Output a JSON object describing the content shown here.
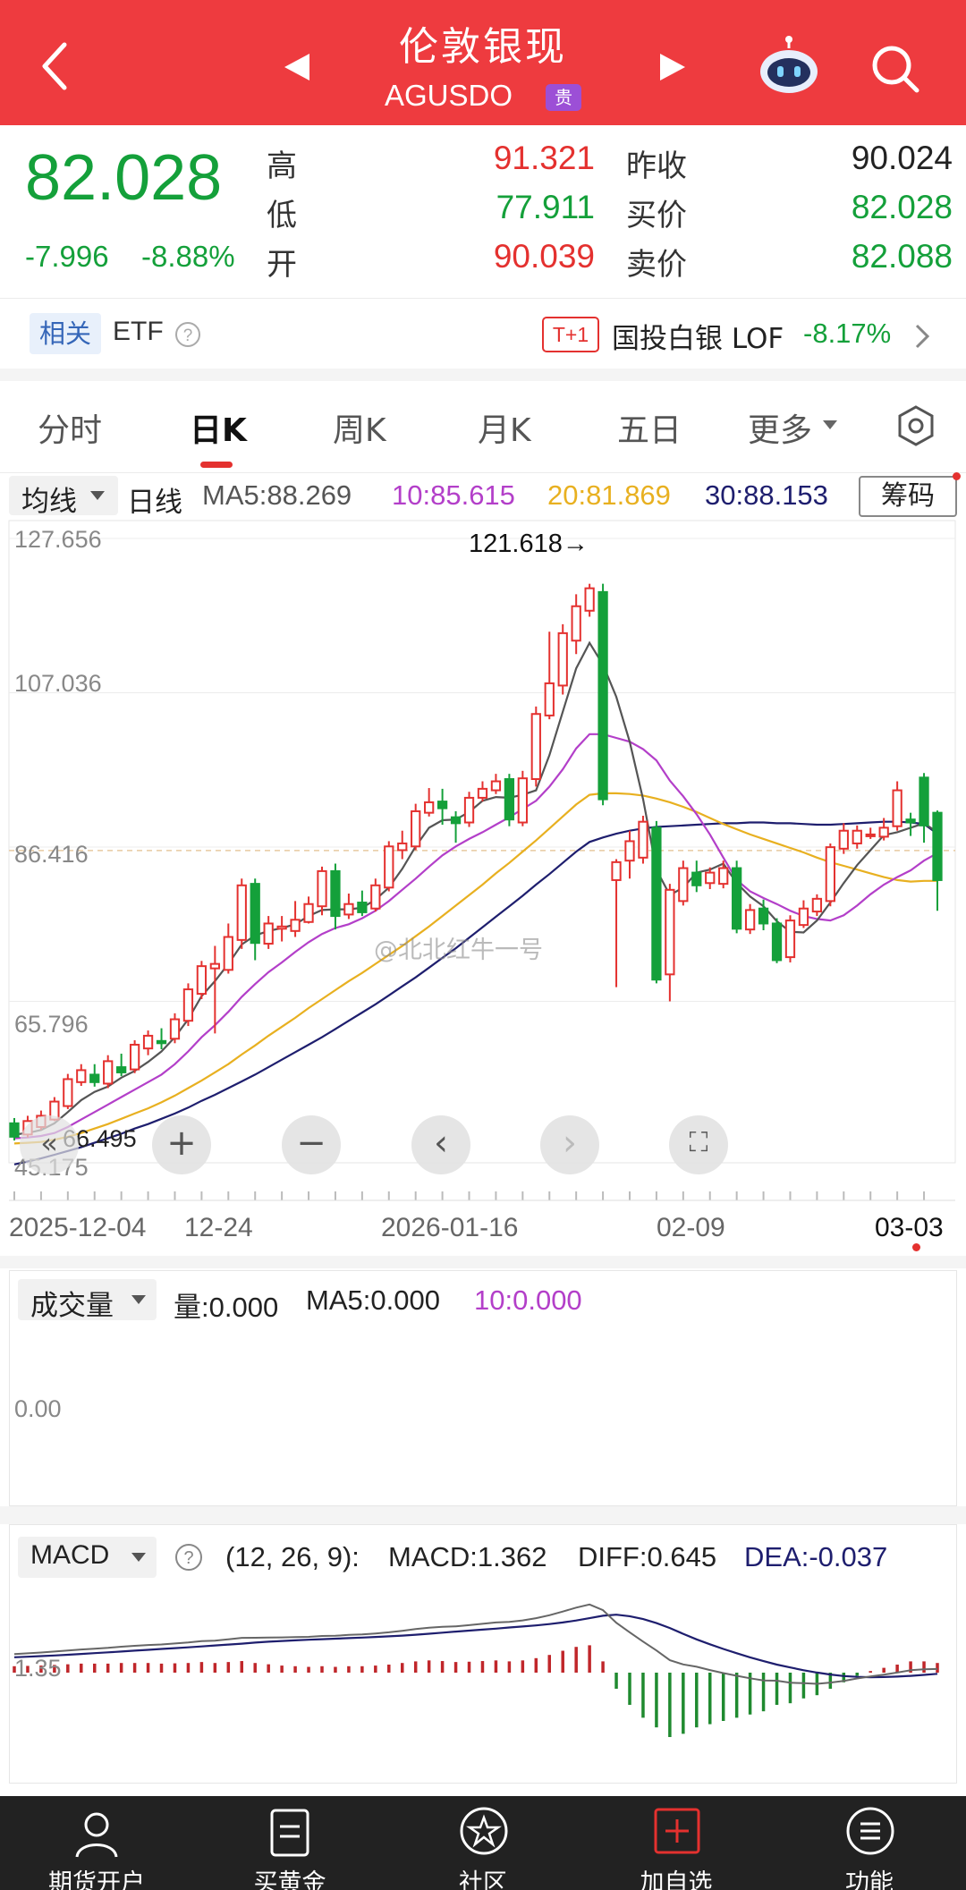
{
  "header": {
    "title": "伦敦银现",
    "code": "AGUSDO",
    "badge": "贵",
    "back_icon": "chevron-left-icon",
    "prev_icon": "triangle-left-icon",
    "next_icon": "triangle-right-icon",
    "robot_icon": "robot-icon",
    "search_icon": "search-icon"
  },
  "quote": {
    "price": "82.028",
    "change": "-7.996",
    "change_pct": "-8.88%",
    "high_label": "高",
    "high": "91.321",
    "low_label": "低",
    "low": "77.911",
    "open_label": "开",
    "open": "90.039",
    "prev_close_label": "昨收",
    "prev_close": "90.024",
    "bid_label": "买价",
    "bid": "82.028",
    "ask_label": "卖价",
    "ask": "82.088"
  },
  "related": {
    "tag": "相关",
    "etf": "ETF",
    "t1": "T+1",
    "fund": "国投白银 LOF",
    "fund_change": "-8.17%"
  },
  "tabs": [
    "分时",
    "日K",
    "周K",
    "月K",
    "五日",
    "更多"
  ],
  "active_tab": 1,
  "ma_bar": {
    "selector": "均线",
    "period": "日线",
    "ma5": "MA5:88.269",
    "ma10": "10:85.615",
    "ma20": "20:81.869",
    "ma30": "30:88.153",
    "chip_button": "筹码"
  },
  "price_axis": [
    "127.656",
    "107.036",
    "86.416",
    "65.796",
    "45.175"
  ],
  "low_marker": "66.495",
  "peak_marker": "121.618→",
  "watermark": "@北北红牛一号",
  "dates": [
    "2025-12-04",
    "12-24",
    "2026-01-16",
    "02-09",
    "03-03"
  ],
  "volume": {
    "selector": "成交量",
    "vol": "量:0.000",
    "ma5": "MA5:0.000",
    "ma10": "10:0.000",
    "axis": "0.00"
  },
  "macd": {
    "selector": "MACD",
    "params": "(12, 26, 9):",
    "macd": "MACD:1.362",
    "diff": "DIFF:0.645",
    "dea": "DEA:-0.037",
    "axis": "1.35"
  },
  "bottom_nav": [
    {
      "label": "期货开户",
      "icon": "person-icon"
    },
    {
      "label": "买黄金",
      "icon": "document-icon"
    },
    {
      "label": "社区",
      "icon": "star-badge-icon"
    },
    {
      "label": "加自选",
      "icon": "plus-square-icon"
    },
    {
      "label": "功能",
      "icon": "menu-circle-icon"
    }
  ],
  "colors": {
    "header_bg": "#ee3b3f",
    "up": "#e4312f",
    "down": "#14a03a",
    "ma5": "#555555",
    "ma10": "#b33fc9",
    "ma20": "#e8b020",
    "ma30": "#1e1e6e",
    "nav_bg": "#222222"
  },
  "chart_data": {
    "type": "candlestick",
    "y_range": [
      45.175,
      127.656
    ],
    "candles": [
      {
        "o": 49.5,
        "c": 47.7,
        "h": 50.2,
        "l": 47.2
      },
      {
        "o": 48.0,
        "c": 49.8,
        "h": 50.5,
        "l": 47.6
      },
      {
        "o": 49.0,
        "c": 50.5,
        "h": 51.2,
        "l": 48.6
      },
      {
        "o": 50.0,
        "c": 52.4,
        "h": 53.0,
        "l": 49.8
      },
      {
        "o": 51.8,
        "c": 55.4,
        "h": 56.1,
        "l": 51.4
      },
      {
        "o": 55.0,
        "c": 56.6,
        "h": 57.4,
        "l": 54.5
      },
      {
        "o": 56.0,
        "c": 55.0,
        "h": 57.4,
        "l": 54.4
      },
      {
        "o": 54.8,
        "c": 57.8,
        "h": 58.6,
        "l": 54.2
      },
      {
        "o": 57.0,
        "c": 56.3,
        "h": 58.8,
        "l": 55.8
      },
      {
        "o": 56.7,
        "c": 60.0,
        "h": 60.6,
        "l": 56.2
      },
      {
        "o": 59.5,
        "c": 61.2,
        "h": 61.9,
        "l": 58.6
      },
      {
        "o": 60.5,
        "c": 60.2,
        "h": 62.2,
        "l": 59.4
      },
      {
        "o": 60.8,
        "c": 63.4,
        "h": 64.2,
        "l": 60.2
      },
      {
        "o": 63.2,
        "c": 67.4,
        "h": 68.2,
        "l": 62.5
      },
      {
        "o": 66.8,
        "c": 70.5,
        "h": 71.2,
        "l": 66.1
      },
      {
        "o": 70.2,
        "c": 70.8,
        "h": 73.2,
        "l": 61.5
      },
      {
        "o": 70.0,
        "c": 74.4,
        "h": 76.2,
        "l": 69.5
      },
      {
        "o": 74.0,
        "c": 81.3,
        "h": 82.2,
        "l": 72.8
      },
      {
        "o": 81.5,
        "c": 73.6,
        "h": 82.2,
        "l": 71.3
      },
      {
        "o": 73.5,
        "c": 76.2,
        "h": 77.2,
        "l": 72.8
      },
      {
        "o": 75.5,
        "c": 75.8,
        "h": 77.2,
        "l": 73.8
      },
      {
        "o": 75.2,
        "c": 76.7,
        "h": 79.2,
        "l": 74.4
      },
      {
        "o": 76.4,
        "c": 78.8,
        "h": 79.8,
        "l": 76.2
      },
      {
        "o": 78.5,
        "c": 83.2,
        "h": 83.8,
        "l": 77.3
      },
      {
        "o": 83.2,
        "c": 77.2,
        "h": 84.2,
        "l": 75.4
      },
      {
        "o": 77.4,
        "c": 78.8,
        "h": 80.2,
        "l": 76.8
      },
      {
        "o": 79.0,
        "c": 77.7,
        "h": 80.6,
        "l": 77.2
      },
      {
        "o": 78.2,
        "c": 81.3,
        "h": 82.2,
        "l": 77.8
      },
      {
        "o": 81.0,
        "c": 86.5,
        "h": 87.2,
        "l": 80.5
      },
      {
        "o": 86.0,
        "c": 86.9,
        "h": 88.6,
        "l": 84.8
      },
      {
        "o": 86.5,
        "c": 91.2,
        "h": 92.2,
        "l": 86.0
      },
      {
        "o": 91.0,
        "c": 92.4,
        "h": 94.3,
        "l": 90.5
      },
      {
        "o": 92.5,
        "c": 91.6,
        "h": 94.2,
        "l": 89.4
      },
      {
        "o": 90.4,
        "c": 89.6,
        "h": 91.2,
        "l": 87.0
      },
      {
        "o": 89.7,
        "c": 93.0,
        "h": 93.8,
        "l": 89.1
      },
      {
        "o": 93.0,
        "c": 94.2,
        "h": 95.2,
        "l": 92.5
      },
      {
        "o": 94.0,
        "c": 95.2,
        "h": 96.2,
        "l": 93.5
      },
      {
        "o": 95.5,
        "c": 90.1,
        "h": 96.2,
        "l": 89.2
      },
      {
        "o": 89.7,
        "c": 95.6,
        "h": 96.6,
        "l": 89.2
      },
      {
        "o": 95.5,
        "c": 104.2,
        "h": 105.2,
        "l": 94.5
      },
      {
        "o": 104.0,
        "c": 108.3,
        "h": 115.2,
        "l": 103.5
      },
      {
        "o": 108.0,
        "c": 115.0,
        "h": 116.2,
        "l": 106.8
      },
      {
        "o": 114.0,
        "c": 118.6,
        "h": 120.2,
        "l": 112.2
      },
      {
        "o": 118.0,
        "c": 121.0,
        "h": 121.6,
        "l": 117.2
      },
      {
        "o": 120.5,
        "c": 92.8,
        "h": 121.6,
        "l": 92.0
      },
      {
        "o": 82.0,
        "c": 84.4,
        "h": 84.8,
        "l": 67.7
      },
      {
        "o": 84.6,
        "c": 87.2,
        "h": 88.6,
        "l": 82.2
      },
      {
        "o": 85.0,
        "c": 89.8,
        "h": 90.6,
        "l": 84.2
      },
      {
        "o": 89.0,
        "c": 68.7,
        "h": 89.9,
        "l": 68.2
      },
      {
        "o": 69.4,
        "c": 80.7,
        "h": 81.5,
        "l": 65.8
      },
      {
        "o": 79.2,
        "c": 83.6,
        "h": 84.6,
        "l": 78.6
      },
      {
        "o": 83.0,
        "c": 81.3,
        "h": 84.6,
        "l": 80.4
      },
      {
        "o": 81.6,
        "c": 83.0,
        "h": 83.7,
        "l": 80.8
      },
      {
        "o": 81.5,
        "c": 83.6,
        "h": 84.6,
        "l": 80.9
      },
      {
        "o": 83.6,
        "c": 75.5,
        "h": 84.6,
        "l": 74.9
      },
      {
        "o": 75.4,
        "c": 78.0,
        "h": 78.8,
        "l": 74.8
      },
      {
        "o": 78.2,
        "c": 76.2,
        "h": 79.4,
        "l": 75.3
      },
      {
        "o": 76.2,
        "c": 71.3,
        "h": 76.9,
        "l": 70.9
      },
      {
        "o": 71.7,
        "c": 76.6,
        "h": 77.3,
        "l": 71.0
      },
      {
        "o": 76.0,
        "c": 78.2,
        "h": 79.3,
        "l": 75.6
      },
      {
        "o": 77.8,
        "c": 79.5,
        "h": 80.1,
        "l": 77.2
      },
      {
        "o": 79.2,
        "c": 86.4,
        "h": 86.9,
        "l": 78.5
      },
      {
        "o": 86.2,
        "c": 88.6,
        "h": 89.6,
        "l": 85.5
      },
      {
        "o": 86.9,
        "c": 88.6,
        "h": 89.3,
        "l": 86.2
      },
      {
        "o": 88.1,
        "c": 88.1,
        "h": 89.0,
        "l": 87.5
      },
      {
        "o": 87.8,
        "c": 89.0,
        "h": 90.3,
        "l": 87.3
      },
      {
        "o": 89.2,
        "c": 94.0,
        "h": 95.2,
        "l": 88.6
      },
      {
        "o": 90.1,
        "c": 89.7,
        "h": 91.0,
        "l": 87.9
      },
      {
        "o": 95.7,
        "c": 89.3,
        "h": 96.3,
        "l": 87.0
      },
      {
        "o": 91.0,
        "c": 82.0,
        "h": 91.3,
        "l": 77.9
      }
    ],
    "ma5": [
      48.0,
      48.2,
      48.6,
      49.5,
      51.0,
      52.6,
      53.7,
      54.4,
      55.6,
      56.5,
      57.7,
      59.1,
      61.0,
      63.4,
      66.5,
      68.5,
      70.8,
      73.4,
      74.6,
      75.2,
      75.6,
      76.1,
      77.2,
      78.0,
      78.1,
      78.1,
      78.3,
      79.4,
      81.0,
      83.5,
      86.5,
      89.0,
      90.0,
      90.1,
      91.1,
      92.6,
      93.1,
      93.0,
      93.4,
      94.0,
      98.7,
      104.5,
      110.3,
      113.7,
      110.8,
      106.5,
      100.5,
      92.8,
      83.4,
      80.0,
      81.0,
      83.0,
      83.4,
      84.2,
      81.6,
      79.8,
      78.5,
      76.5,
      75.1,
      75.0,
      76.6,
      79.0,
      81.6,
      84.0,
      86.0,
      88.0,
      88.4,
      89.0,
      89.6,
      88.4
    ],
    "ma10": [
      47.5,
      47.6,
      47.8,
      48.2,
      49.0,
      50.0,
      51.0,
      52.0,
      53.0,
      54.0,
      55.0,
      56.0,
      57.4,
      59.1,
      61.0,
      62.6,
      64.4,
      66.4,
      68.1,
      69.7,
      71.0,
      72.4,
      73.7,
      74.8,
      75.6,
      76.1,
      76.9,
      77.9,
      79.2,
      80.7,
      82.2,
      83.8,
      85.3,
      86.5,
      87.5,
      88.4,
      89.4,
      90.4,
      91.5,
      92.6,
      94.5,
      96.8,
      99.6,
      101.5,
      101.5,
      101.0,
      100.5,
      99.5,
      98.0,
      95.3,
      93.2,
      90.8,
      88.1,
      85.0,
      82.0,
      80.5,
      79.6,
      78.8,
      77.9,
      77.2,
      76.8,
      76.6,
      77.3,
      78.6,
      80.1,
      81.4,
      82.4,
      83.3,
      84.6,
      85.6
    ],
    "ma20": [
      46.8,
      46.9,
      47.0,
      47.3,
      47.7,
      48.2,
      48.8,
      49.4,
      50.1,
      50.8,
      51.5,
      52.3,
      53.2,
      54.2,
      55.2,
      56.3,
      57.4,
      58.7,
      59.9,
      61.2,
      62.4,
      63.6,
      64.9,
      66.1,
      67.3,
      68.5,
      69.6,
      70.8,
      72.0,
      73.2,
      74.5,
      75.8,
      77.2,
      78.6,
      80.0,
      81.4,
      82.9,
      84.3,
      85.8,
      87.3,
      88.9,
      90.5,
      92.1,
      93.4,
      93.6,
      93.6,
      93.5,
      93.3,
      92.9,
      92.4,
      91.8,
      91.1,
      90.3,
      89.5,
      88.8,
      88.1,
      87.5,
      86.9,
      86.3,
      85.7,
      85.0,
      84.4,
      83.9,
      83.4,
      82.9,
      82.4,
      82.0,
      81.8,
      81.9,
      81.9
    ],
    "ma30": [
      44.0,
      44.4,
      44.8,
      45.3,
      45.8,
      46.3,
      46.9,
      47.5,
      48.1,
      48.8,
      49.4,
      50.1,
      50.8,
      51.6,
      52.5,
      53.3,
      54.2,
      55.1,
      56.0,
      57.0,
      58.0,
      59.0,
      60.0,
      61.0,
      62.1,
      63.2,
      64.3,
      65.4,
      66.6,
      67.8,
      69.0,
      70.3,
      71.6,
      72.9,
      74.3,
      75.7,
      77.1,
      78.5,
      79.9,
      81.4,
      82.8,
      84.3,
      85.8,
      87.1,
      87.7,
      88.2,
      88.6,
      88.9,
      89.1,
      89.2,
      89.3,
      89.4,
      89.5,
      89.6,
      89.6,
      89.7,
      89.7,
      89.6,
      89.6,
      89.5,
      89.4,
      89.4,
      89.5,
      89.6,
      89.7,
      89.8,
      89.8,
      89.7,
      89.5,
      88.2
    ],
    "macd_hist": [
      0.2,
      0.21,
      0.22,
      0.24,
      0.26,
      0.28,
      0.28,
      0.28,
      0.3,
      0.3,
      0.3,
      0.28,
      0.29,
      0.3,
      0.33,
      0.3,
      0.33,
      0.36,
      0.3,
      0.26,
      0.22,
      0.2,
      0.18,
      0.2,
      0.18,
      0.2,
      0.2,
      0.22,
      0.25,
      0.3,
      0.35,
      0.38,
      0.36,
      0.33,
      0.34,
      0.36,
      0.38,
      0.35,
      0.38,
      0.45,
      0.55,
      0.68,
      0.8,
      0.85,
      0.35,
      -0.5,
      -1.0,
      -1.4,
      -1.7,
      -2.0,
      -1.9,
      -1.7,
      -1.6,
      -1.5,
      -1.4,
      -1.3,
      -1.2,
      -1.0,
      -0.95,
      -0.8,
      -0.7,
      -0.5,
      -0.3,
      -0.1,
      0.05,
      0.15,
      0.25,
      0.35,
      0.35,
      0.3
    ]
  }
}
